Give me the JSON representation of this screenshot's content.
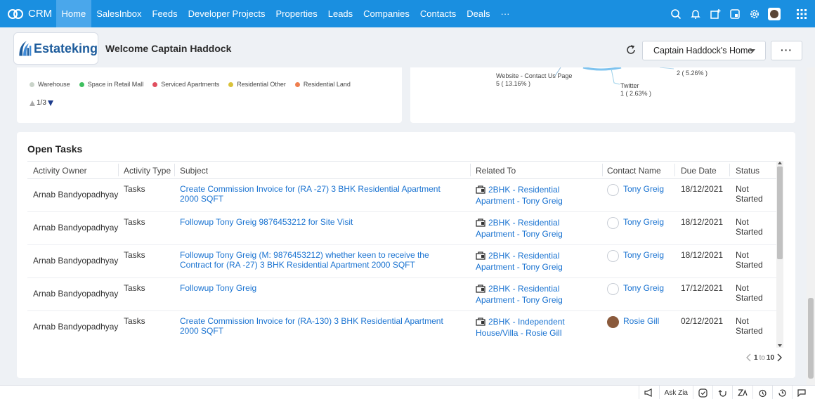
{
  "nav": {
    "brand": "CRM",
    "tabs": [
      "Home",
      "SalesInbox",
      "Feeds",
      "Developer Projects",
      "Properties",
      "Leads",
      "Companies",
      "Contacts",
      "Deals"
    ],
    "more": "···",
    "active_tab": "Home"
  },
  "header": {
    "logo_text": "Estateking",
    "welcome": "Welcome Captain Haddock",
    "home_select": "Captain Haddock's Home",
    "more_label": "···"
  },
  "left_chart": {
    "legend": [
      {
        "label": "Warehouse",
        "color": "#c9d3c9"
      },
      {
        "label": "Space in Retail Mall",
        "color": "#3fbf5f"
      },
      {
        "label": "Serviced Apartments",
        "color": "#e04f5f"
      },
      {
        "label": "Residential Other",
        "color": "#d9c23a"
      },
      {
        "label": "Residential Land",
        "color": "#ef7f4f"
      }
    ],
    "pager": "1/3"
  },
  "right_chart": {
    "labels": [
      {
        "name": "Website - Contact Us Page",
        "value": "5 ( 13.16% )"
      },
      {
        "name": "Twitter",
        "value": "1 ( 2.63% )"
      },
      {
        "name": "",
        "value": "2 ( 5.26% )"
      }
    ]
  },
  "tasks": {
    "title": "Open Tasks",
    "columns": [
      "Activity Owner",
      "Activity Type",
      "Subject",
      "Related To",
      "Contact Name",
      "Due Date",
      "Status"
    ],
    "rows": [
      {
        "owner": "Arnab Bandyopadhyay",
        "type": "Tasks",
        "subject": "Create Commission Invoice for (RA -27) 3 BHK Residential Apartment 2000 SQFT",
        "related": "2BHK - Residential Apartment - Tony Greig",
        "contact": "Tony Greig",
        "due": "18/12/2021",
        "status": "Not Started",
        "photo": false
      },
      {
        "owner": "Arnab Bandyopadhyay",
        "type": "Tasks",
        "subject": "Followup Tony Greig 9876453212 for Site Visit",
        "related": "2BHK - Residential Apartment - Tony Greig",
        "contact": "Tony Greig",
        "due": "18/12/2021",
        "status": "Not Started",
        "photo": false
      },
      {
        "owner": "Arnab Bandyopadhyay",
        "type": "Tasks",
        "subject": "Followup Tony Greig (M: 9876453212) whether keen to receive the Contract for (RA -27) 3 BHK Residential Apartment 2000 SQFT",
        "related": "2BHK - Residential Apartment - Tony Greig",
        "contact": "Tony Greig",
        "due": "18/12/2021",
        "status": "Not Started",
        "photo": false
      },
      {
        "owner": "Arnab Bandyopadhyay",
        "type": "Tasks",
        "subject": "Followup Tony Greig",
        "related": "2BHK - Residential Apartment - Tony Greig",
        "contact": "Tony Greig",
        "due": "17/12/2021",
        "status": "Not Started",
        "photo": false
      },
      {
        "owner": "Arnab Bandyopadhyay",
        "type": "Tasks",
        "subject": "Create Commission Invoice for (RA-130) 3 BHK Residential Apartment 2000 SQFT",
        "related": "2BHK - Independent House/Villa - Rosie Gill",
        "contact": "Rosie Gill",
        "due": "02/12/2021",
        "status": "Not Started",
        "photo": true
      }
    ],
    "pager": {
      "from": "1",
      "to_word": "to",
      "to": "10"
    }
  },
  "bottombar": {
    "ask_zia": "Ask Zia"
  }
}
